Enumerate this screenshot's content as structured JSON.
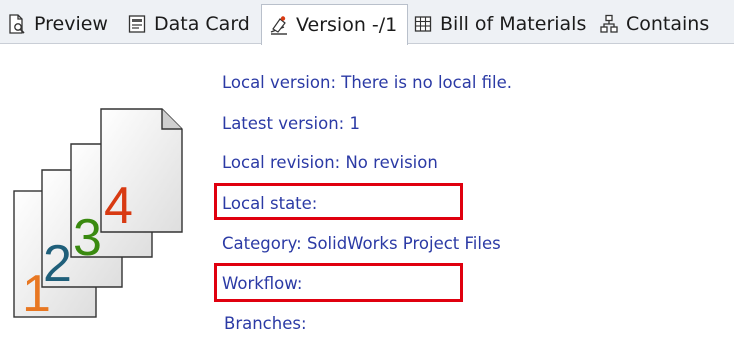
{
  "tabs": [
    {
      "label": "Preview",
      "icon": "preview-icon"
    },
    {
      "label": "Data Card",
      "icon": "data-card-icon"
    },
    {
      "label": "Version -/1",
      "icon": "version-icon",
      "active": true
    },
    {
      "label": "Bill of Materials",
      "icon": "bill-of-materials-icon"
    },
    {
      "label": "Contains",
      "icon": "contains-icon"
    }
  ],
  "version_graphic": {
    "digits": [
      "1",
      "2",
      "3",
      "4"
    ],
    "icon": "version-pages-icon"
  },
  "info": {
    "local_version": "Local version: There is no local file.",
    "latest_version": "Latest version: 1",
    "local_revision": "Local revision: No revision",
    "local_state": "Local state:",
    "category": "Category: SolidWorks Project Files",
    "workflow": "Workflow:",
    "branches": "Branches:"
  },
  "colors": {
    "text": "#2b3aa5",
    "highlight": "#e0000f",
    "digit1": "#e87722",
    "digit2": "#1f5f7a",
    "digit3": "#3a8a10",
    "digit4": "#d83a12"
  }
}
